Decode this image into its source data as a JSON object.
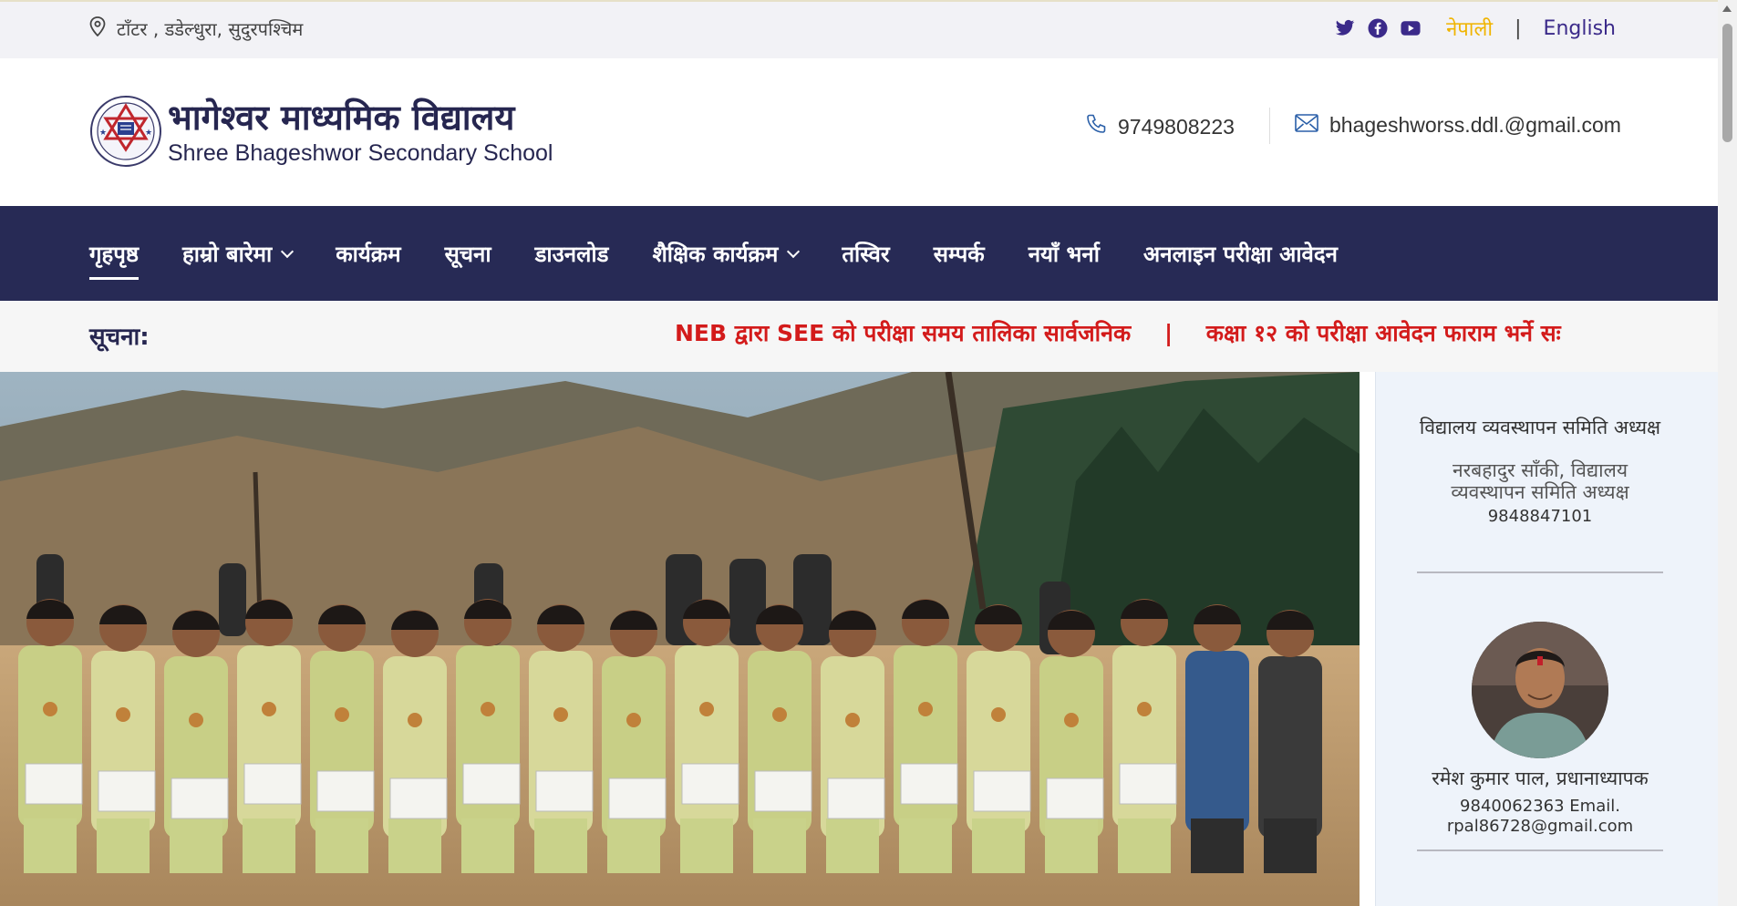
{
  "topbar": {
    "location": "टाँटर , डडेल्धुरा, सुदुरपश्चिम",
    "lang_nepali": "नेपाली",
    "lang_separator": "|",
    "lang_english": "English",
    "social_icons": [
      "twitter-icon",
      "facebook-icon",
      "youtube-icon"
    ]
  },
  "header": {
    "name_nepali": "भागेश्वर माध्यमिक विद्यालय",
    "name_english": "Shree Bhageshwor Secondary School",
    "phone": "9749808223",
    "email": "bhageshworss.ddl.@gmail.com"
  },
  "nav": {
    "items": [
      {
        "label": "गृहपृष्ठ",
        "active": true,
        "dropdown": false
      },
      {
        "label": "हाम्रो बारेमा",
        "active": false,
        "dropdown": true
      },
      {
        "label": "कार्यक्रम",
        "active": false,
        "dropdown": false
      },
      {
        "label": "सूचना",
        "active": false,
        "dropdown": false
      },
      {
        "label": "डाउनलोड",
        "active": false,
        "dropdown": false
      },
      {
        "label": "शैक्षिक कार्यक्रम",
        "active": false,
        "dropdown": true
      },
      {
        "label": "तस्विर",
        "active": false,
        "dropdown": false
      },
      {
        "label": "सम्पर्क",
        "active": false,
        "dropdown": false
      },
      {
        "label": "नयाँ भर्ना",
        "active": false,
        "dropdown": false
      },
      {
        "label": "अनलाइन परीक्षा आवेदन",
        "active": false,
        "dropdown": false
      }
    ]
  },
  "notice": {
    "label": "सूचना:",
    "items": [
      "NEB द्वारा SEE को परीक्षा समय तालिका सार्वजनिक",
      "कक्षा १२ को परीक्षा आवेदन फाराम भर्ने सः"
    ],
    "separator": "|"
  },
  "sidebar": {
    "card1": {
      "image_alt": "विद्यालय व्यवस्थापन समिति अध्यक्ष",
      "name": "नरबहादुर साँकी, विद्यालय व्यवस्थापन समिति अध्यक्ष",
      "phone": "9848847101"
    },
    "card2": {
      "name": "रमेश कुमार पाल, प्रधानाध्यापक",
      "contact": "9840062363 Email. rpal86728@gmail.com"
    }
  },
  "colors": {
    "nav_bg": "#272a55",
    "brand_text": "#262650",
    "notice_red": "#d31b1b",
    "lang_active": "#f0b400",
    "social": "#3b2a8a"
  }
}
